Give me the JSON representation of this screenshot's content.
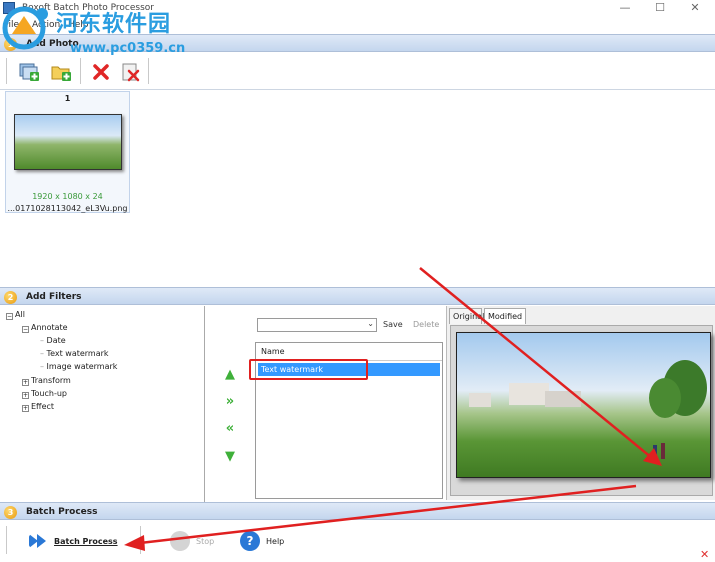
{
  "window": {
    "title": "Boxoft Batch Photo Processor",
    "minimize": "—",
    "maximize": "☐",
    "close": "✕"
  },
  "menu": {
    "items": [
      "File",
      "Action",
      "Help"
    ]
  },
  "watermark": {
    "title": "河东软件园",
    "url": "www.pc0359.cn"
  },
  "sections": {
    "add_photo": {
      "num": "1",
      "title": "Add Photo"
    },
    "add_filters": {
      "num": "2",
      "title": "Add Filters"
    },
    "batch_process": {
      "num": "3",
      "title": "Batch Process"
    }
  },
  "photo": {
    "index": "1",
    "dims": "1920 x 1080 x 24",
    "filename": "...0171028113042_eL3Vu.png"
  },
  "tree": {
    "all": "All",
    "annotate": "Annotate",
    "date": "Date",
    "text_watermark": "Text watermark",
    "image_watermark": "Image watermark",
    "transform": "Transform",
    "touch_up": "Touch-up",
    "effect": "Effect"
  },
  "filter_controls": {
    "save": "Save",
    "delete": "Delete",
    "select_value": ""
  },
  "filter_list": {
    "header": "Name",
    "selected": "Text watermark"
  },
  "preview": {
    "tab_original": "Original",
    "tab_modified": "Modified"
  },
  "batch": {
    "batch_process": "Batch Process",
    "stop": "Stop",
    "help": "Help"
  },
  "colors": {
    "accent_blue": "#3399ff",
    "annotation_red": "#e02020",
    "watermark_blue": "#2a9de0"
  }
}
